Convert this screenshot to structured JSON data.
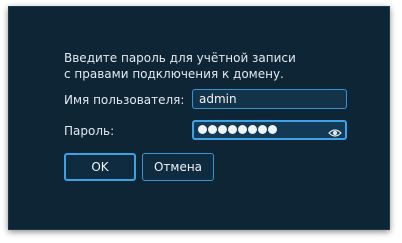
{
  "dialog": {
    "message_lines": [
      "Введите пароль для учётной записи",
      "с правами подключения к домену."
    ],
    "username_label": "Имя пользователя:",
    "username_value": "admin",
    "password_label": "Пароль:",
    "password_masked_length": 8,
    "reveal_icon": "eye-icon",
    "ok_label": "OK",
    "cancel_label": "Отмена"
  },
  "colors": {
    "background": "#0d2535",
    "accent": "#3ea2e6",
    "text": "#e3e9ee"
  }
}
